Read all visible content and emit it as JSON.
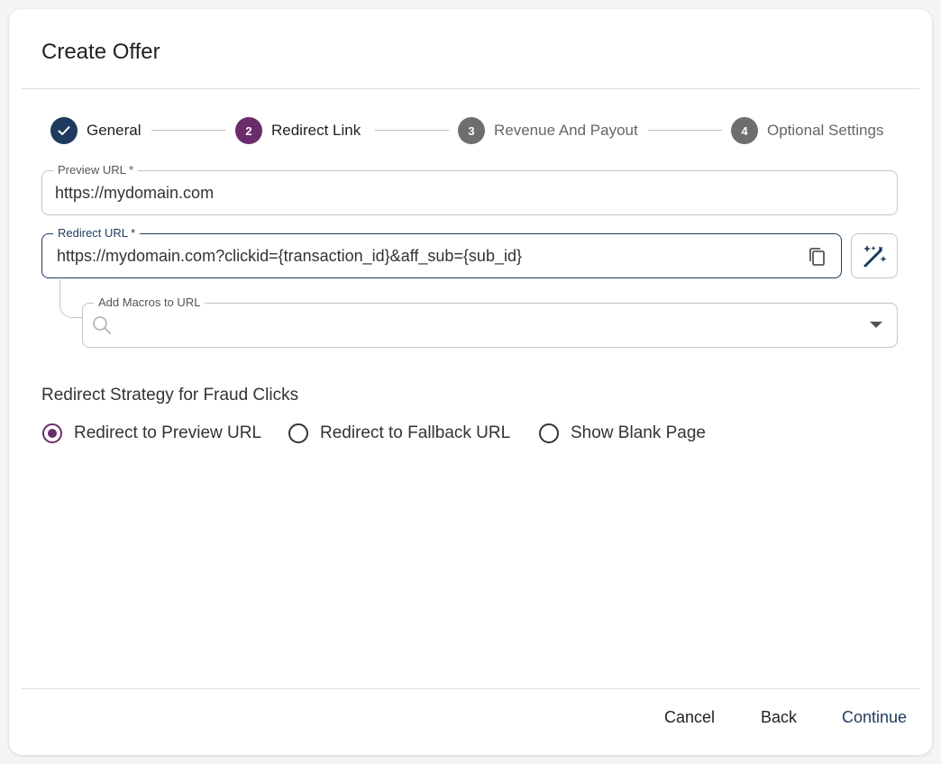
{
  "dialog": {
    "title": "Create Offer"
  },
  "stepper": {
    "steps": [
      {
        "number": "",
        "label": "General",
        "state": "completed"
      },
      {
        "number": "2",
        "label": "Redirect Link",
        "state": "active"
      },
      {
        "number": "3",
        "label": "Revenue And Payout",
        "state": "pending"
      },
      {
        "number": "4",
        "label": "Optional Settings",
        "state": "pending"
      }
    ]
  },
  "preview_url": {
    "label": "Preview URL *",
    "value": "https://mydomain.com"
  },
  "redirect_url": {
    "label": "Redirect URL *",
    "value": "https://mydomain.com?clickid={transaction_id}&aff_sub={sub_id}"
  },
  "macros": {
    "label": "Add Macros to URL",
    "value": ""
  },
  "fraud": {
    "title": "Redirect Strategy for Fraud Clicks",
    "options": [
      {
        "label": "Redirect to Preview URL",
        "checked": true
      },
      {
        "label": "Redirect to Fallback URL",
        "checked": false
      },
      {
        "label": "Show Blank Page",
        "checked": false
      }
    ]
  },
  "footer": {
    "cancel": "Cancel",
    "back": "Back",
    "continue": "Continue"
  },
  "colors": {
    "completed": "#1e3a5f",
    "active": "#6b2c6b",
    "pending": "#6e6e6e",
    "primary_text": "#1e3a5f"
  }
}
